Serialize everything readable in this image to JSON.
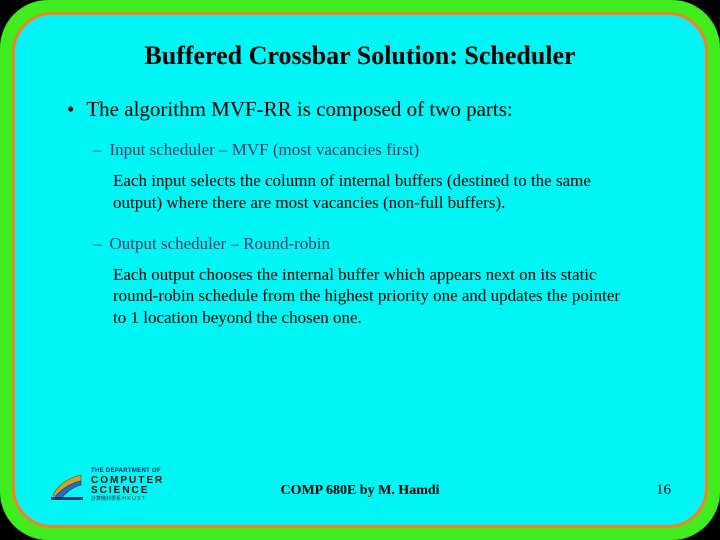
{
  "title": "Buffered Crossbar Solution: Scheduler",
  "bullet": "The algorithm MVF-RR is composed of two parts:",
  "sub1_head": "Input scheduler – MVF (most vacancies first)",
  "sub1_body": "Each input selects the column of internal buffers (destined to the same output) where there are most vacancies (non-full buffers).",
  "sub2_head": "Output scheduler – Round-robin",
  "sub2_body": "Each output chooses the internal buffer which appears next on its static round-robin schedule from the highest priority one and updates the pointer to  1 location beyond the chosen one.",
  "footer": "COMP 680E by M. Hamdi",
  "slide_number": "16",
  "logo": {
    "line1": "THE DEPARTMENT OF",
    "line2": "COMPUTER SCIENCE",
    "line3": "計算機科學系   H K U S T"
  }
}
